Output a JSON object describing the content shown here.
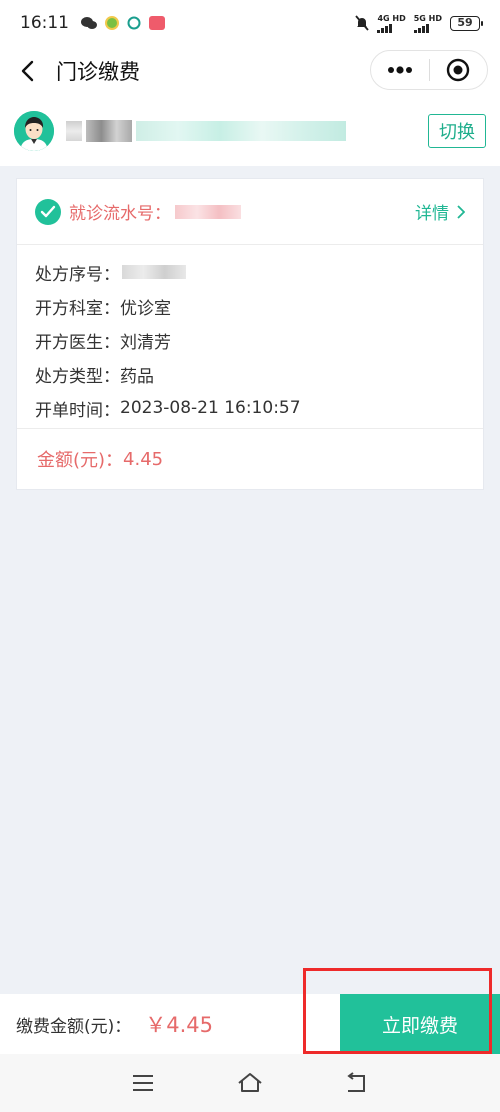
{
  "status_bar": {
    "time": "16:11",
    "network_1": "4G HD",
    "network_2": "5G HD",
    "battery": "59"
  },
  "nav": {
    "title": "门诊缴费",
    "back_icon": "chevron-left-icon",
    "more_icon": "more-dots-icon",
    "target_icon": "target-icon"
  },
  "patient": {
    "switch_label": "切换"
  },
  "card": {
    "visit_no_label": "就诊流水号：",
    "detail_label": "详情",
    "rows": [
      {
        "label": "处方序号：",
        "value": ""
      },
      {
        "label": "开方科室：",
        "value": "优诊室"
      },
      {
        "label": "开方医生：",
        "value": "刘清芳"
      },
      {
        "label": "处方类型：",
        "value": "药品"
      },
      {
        "label": "开单时间：",
        "value": "2023-08-21 16:10:57"
      }
    ],
    "amount_label": "金额(元)：",
    "amount_value": "4.45"
  },
  "pay_bar": {
    "label": "缴费金额(元)：",
    "amount": "￥4.45",
    "button": "立即缴费"
  },
  "colors": {
    "accent": "#21c19a",
    "price": "#e66a6a",
    "highlight_box": "#ee2a2a"
  }
}
